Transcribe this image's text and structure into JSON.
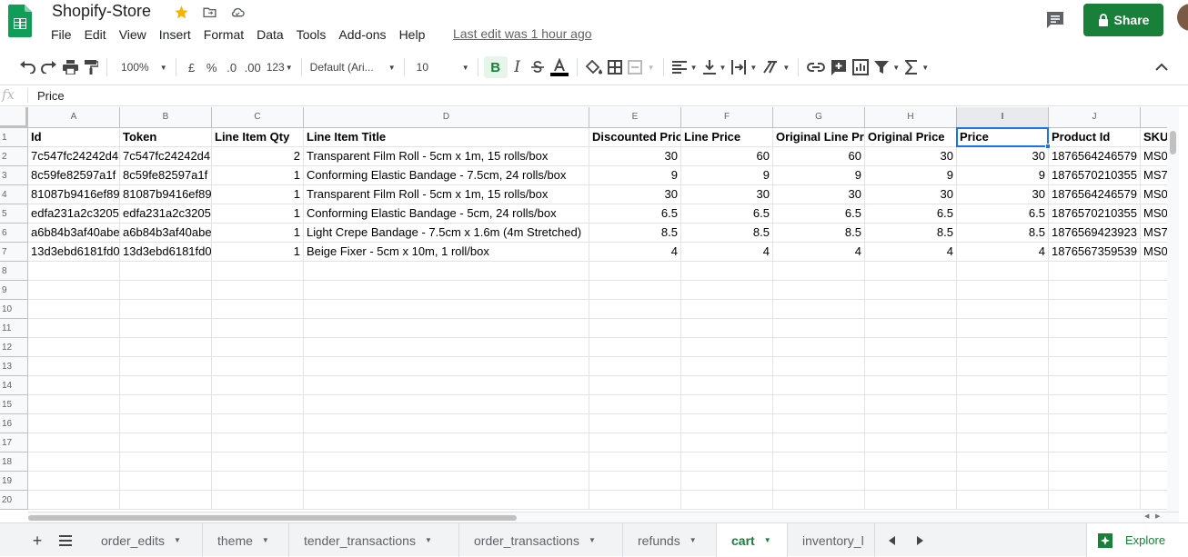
{
  "doc": {
    "title": "Shopify-Store",
    "last_edit": "Last edit was 1 hour ago",
    "share_label": "Share"
  },
  "menu": [
    "File",
    "Edit",
    "View",
    "Insert",
    "Format",
    "Data",
    "Tools",
    "Add-ons",
    "Help"
  ],
  "toolbar": {
    "zoom": "100%",
    "currency": "£",
    "percent": "%",
    "decrease_decimal": ".0",
    "increase_decimal": ".00",
    "more_formats": "123",
    "font_family": "Default (Ari...",
    "font_size": "10",
    "bold": "B"
  },
  "formula_bar": {
    "fx": "fx",
    "value": "Price"
  },
  "columns": [
    "A",
    "B",
    "C",
    "D",
    "E",
    "F",
    "G",
    "H",
    "I",
    "J",
    ""
  ],
  "rows": [
    "1",
    "2",
    "3",
    "4",
    "5",
    "6",
    "7",
    "8",
    "9",
    "10",
    "11",
    "12",
    "13",
    "14",
    "15",
    "16",
    "17",
    "18",
    "19",
    "20"
  ],
  "header_row": [
    "Id",
    "Token",
    "Line Item Qty",
    "Line Item Title",
    "Discounted Price",
    "Line Price",
    "Original Line Price",
    "Original Price",
    "Price",
    "Product Id",
    "SKU"
  ],
  "data_rows": [
    [
      "7c547fc24242d4",
      "7c547fc24242d4",
      "2",
      "Transparent Film Roll - 5cm x 1m, 15 rolls/box",
      "30",
      "60",
      "60",
      "30",
      "30",
      "1876564246579",
      "MS0"
    ],
    [
      "8c59fe82597a1f",
      "8c59fe82597a1f",
      "1",
      "Conforming Elastic Bandage - 7.5cm, 24 rolls/box",
      "9",
      "9",
      "9",
      "9",
      "9",
      "1876570210355",
      "MS7"
    ],
    [
      "81087b9416ef89",
      "81087b9416ef89",
      "1",
      "Transparent Film Roll - 5cm x 1m, 15 rolls/box",
      "30",
      "30",
      "30",
      "30",
      "30",
      "1876564246579",
      "MS0"
    ],
    [
      "edfa231a2c3205",
      "edfa231a2c3205",
      "1",
      "Conforming Elastic Bandage - 5cm, 24 rolls/box",
      "6.5",
      "6.5",
      "6.5",
      "6.5",
      "6.5",
      "1876570210355",
      "MS0"
    ],
    [
      "a6b84b3af40abe",
      "a6b84b3af40abe",
      "1",
      "Light Crepe Bandage - 7.5cm x 1.6m (4m Stretched)",
      "8.5",
      "8.5",
      "8.5",
      "8.5",
      "8.5",
      "1876569423923",
      "MS7"
    ],
    [
      "13d3ebd6181fd0",
      "13d3ebd6181fd0",
      "1",
      "Beige Fixer - 5cm x 10m, 1 roll/box",
      "4",
      "4",
      "4",
      "4",
      "4",
      "1876567359539",
      "MS0"
    ]
  ],
  "sheet_tabs": [
    "order_edits",
    "theme",
    "tender_transactions",
    "order_transactions",
    "refunds",
    "cart",
    "inventory_l"
  ],
  "active_tab": "cart",
  "explore_label": "Explore",
  "colors": {
    "accent": "#188038",
    "selection": "#1a73e8"
  }
}
